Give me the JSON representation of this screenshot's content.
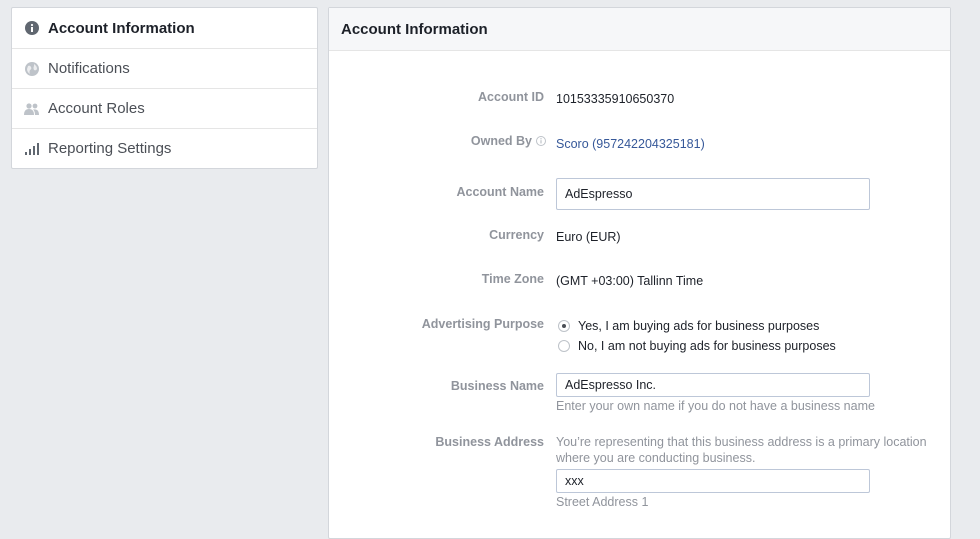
{
  "sidebar": {
    "items": [
      {
        "label": "Account Information",
        "icon": "info-icon"
      },
      {
        "label": "Notifications",
        "icon": "globe-icon"
      },
      {
        "label": "Account Roles",
        "icon": "people-icon"
      },
      {
        "label": "Reporting Settings",
        "icon": "bar-chart-icon"
      }
    ]
  },
  "panel": {
    "title": "Account Information",
    "account_id": {
      "label": "Account ID",
      "value": "10153335910650370"
    },
    "owned_by": {
      "label": "Owned By",
      "value": "Scoro (957242204325181)"
    },
    "account_name": {
      "label": "Account Name",
      "value": "AdEspresso"
    },
    "currency": {
      "label": "Currency",
      "value": "Euro (EUR)"
    },
    "time_zone": {
      "label": "Time Zone",
      "value": "(GMT +03:00) Tallinn Time"
    },
    "advertising_purpose": {
      "label": "Advertising Purpose",
      "options": [
        {
          "label": "Yes, I am buying ads for business purposes",
          "checked": true
        },
        {
          "label": "No, I am not buying ads for business purposes",
          "checked": false
        }
      ]
    },
    "business_name": {
      "label": "Business Name",
      "value": "AdEspresso Inc.",
      "hint": "Enter your own name if you do not have a business name"
    },
    "business_address": {
      "label": "Business Address",
      "description_line1": "You’re representing that this business address is a primary location",
      "description_line2": "where you are conducting business.",
      "street_value": "xxx",
      "street_hint": "Street Address 1"
    }
  },
  "colors": {
    "link": "#365899",
    "muted": "#90949c",
    "background": "#e9ebee"
  }
}
